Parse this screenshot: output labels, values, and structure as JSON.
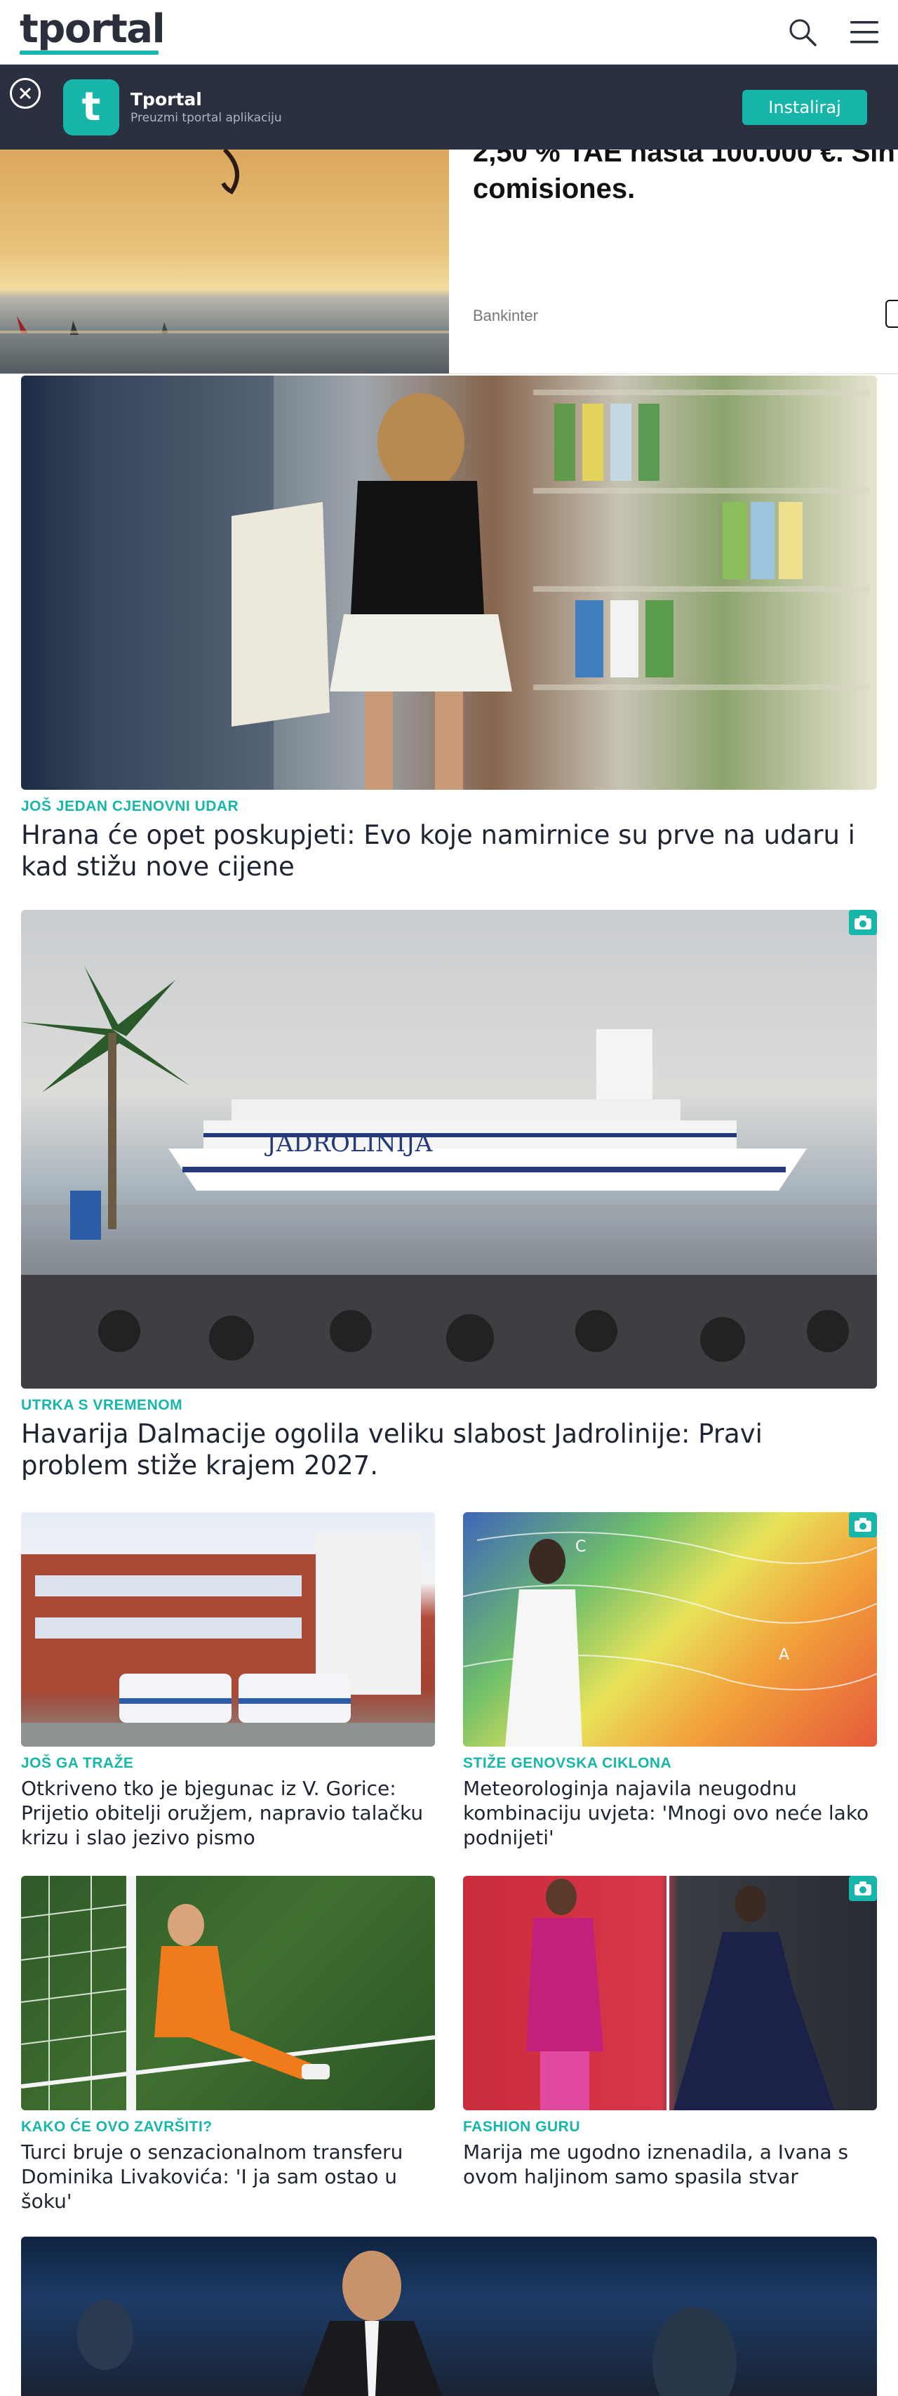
{
  "header": {
    "logo": "tportal",
    "icons": [
      "search-icon",
      "menu-icon"
    ]
  },
  "app_banner": {
    "app_name": "Tportal",
    "app_subtitle": "Preuzmi tportal aplikaciju",
    "app_icon_letter": "t",
    "install_label": "Instaliraj"
  },
  "ad": {
    "text_line1": "2,50 % TAE hasta 100.000 €. Sin",
    "text_line2": "comisiones.",
    "brand": "Bankinter"
  },
  "articles": [
    {
      "kicker": "Još jedan cjenovni udar",
      "title": "Hrana će opet poskupjeti: Evo koje namirnice su prve na udaru i kad stižu nove cijene",
      "has_gallery": false
    },
    {
      "kicker": "Utrka s vremenom",
      "title": "Havarija Dalmacije ogolila veliku slabost Jadrolinije: Pravi problem stiže krajem 2027.",
      "has_gallery": true,
      "photo_text": "JADROLINIJA"
    },
    {
      "kicker": "Još ga traže",
      "title": "Otkriveno tko je bjegunac iz V. Gorice: Prijetio obitelji oružjem, napravio talačku krizu i slao jezivo pismo",
      "has_gallery": false
    },
    {
      "kicker": "Stiže genovska ciklona",
      "title": "Meteorologinja najavila neugodnu kombinaciju uvjeta: 'Mnogi ovo neće lako podnijeti'",
      "has_gallery": true
    },
    {
      "kicker": "Kako će ovo završiti?",
      "title": "Turci bruje o senzacionalnom transferu Dominika Livakovića: 'I ja sam ostao u šoku'",
      "has_gallery": false
    },
    {
      "kicker": "Fashion guru",
      "title": "Marija me ugodno iznenadila, a Ivana s ovom haljinom samo spasila stvar",
      "has_gallery": true
    }
  ],
  "colors": {
    "accent": "#18b5aa",
    "banner_bg": "#2a303f",
    "text": "#1f2433"
  }
}
